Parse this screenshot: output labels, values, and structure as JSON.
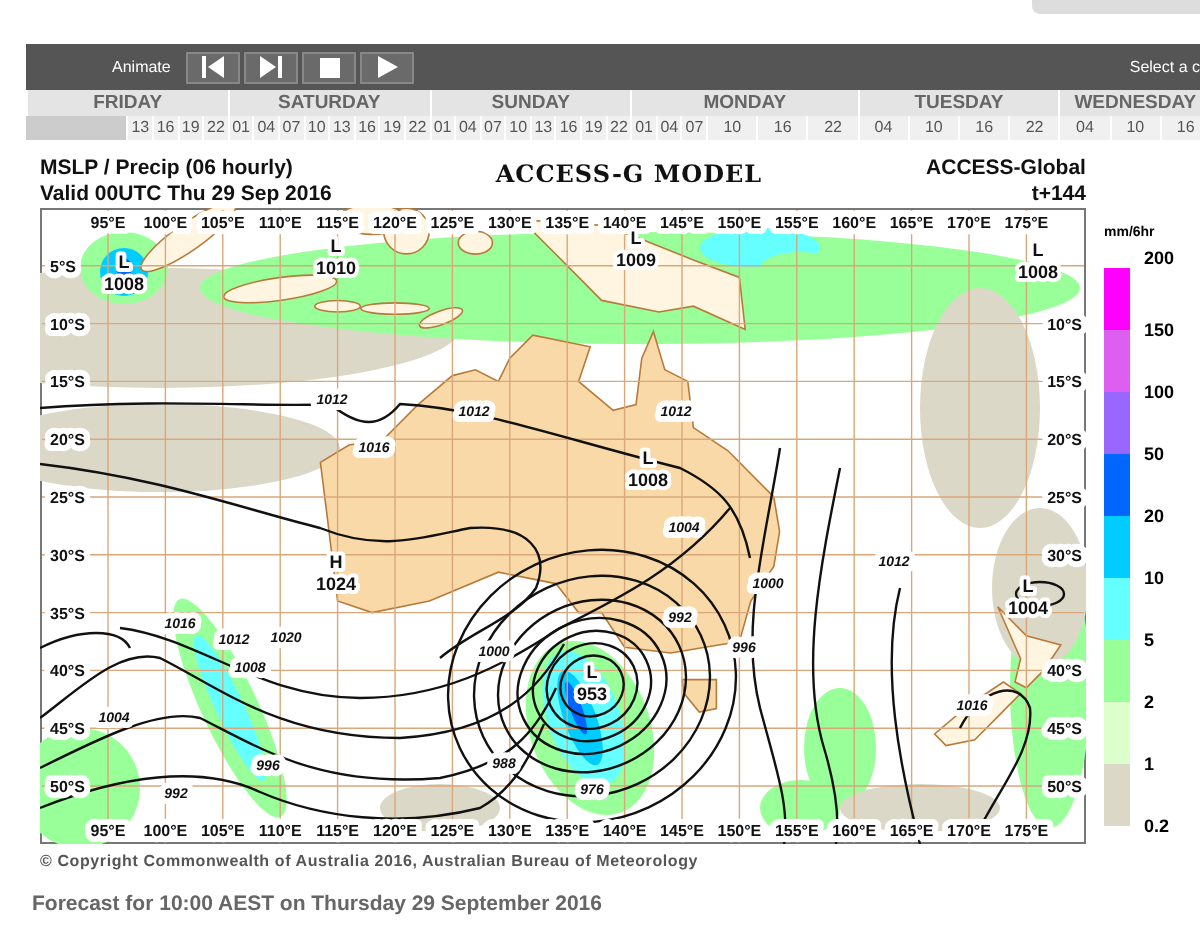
{
  "toolbar": {
    "label": "Animate",
    "buttons": [
      {
        "kind": "first"
      },
      {
        "kind": "next"
      },
      {
        "kind": "stop"
      },
      {
        "kind": "play"
      }
    ],
    "select_label": "Select a c"
  },
  "days": [
    {
      "name": "FRIDAY",
      "hours": [
        "13",
        "16",
        "19",
        "22"
      ]
    },
    {
      "name": "SATURDAY",
      "hours": [
        "01",
        "04",
        "07",
        "10",
        "13",
        "16",
        "19",
        "22"
      ]
    },
    {
      "name": "SUNDAY",
      "hours": [
        "01",
        "04",
        "07",
        "10",
        "13",
        "16",
        "19",
        "22"
      ]
    },
    {
      "name": "MONDAY",
      "hours": [
        "01",
        "04",
        "07",
        "10",
        "16",
        "22"
      ]
    },
    {
      "name": "TUESDAY",
      "hours": [
        "04",
        "10",
        "16",
        "22"
      ]
    },
    {
      "name": "WEDNESDAY",
      "hours": [
        "04",
        "10",
        "16"
      ]
    }
  ],
  "header": {
    "left_lines": [
      "MSLP / Precip  (06 hourly)",
      "Valid 00UTC Thu 29 Sep 2016"
    ],
    "title": "ACCESS-G MODEL",
    "right_lines": [
      "ACCESS-Global",
      "t+144"
    ]
  },
  "map": {
    "top_axis_labels": [
      "95°E",
      "100°E",
      "105°E",
      "110°E",
      "115°E",
      "120°E",
      "125°E",
      "130°E",
      "135°E",
      "140°E",
      "145°E",
      "150°E",
      "155°E",
      "160°E",
      "165°E",
      "170°E",
      "175°E"
    ],
    "bottom_axis_labels": [
      "95°E",
      "100°E",
      "105°E",
      "110°E",
      "115°E",
      "120°E",
      "125°E",
      "130°E",
      "135°E",
      "140°E",
      "145°E",
      "150°E",
      "155°E",
      "160°E",
      "165°E",
      "170°E",
      "175°E"
    ],
    "left_axis_labels": [
      "5°S",
      "10°S",
      "15°S",
      "20°S",
      "25°S",
      "30°S",
      "35°S",
      "40°S",
      "45°S",
      "50°S"
    ],
    "right_axis_labels": [
      "10°S",
      "15°S",
      "20°S",
      "25°S",
      "30°S",
      "40°S",
      "45°S",
      "50°S"
    ],
    "systems": [
      {
        "letter": "L",
        "value": "1008"
      },
      {
        "letter": "L",
        "value": "1010"
      },
      {
        "letter": "L",
        "value": "1009"
      },
      {
        "letter": "L",
        "value": "1008"
      },
      {
        "letter": "H",
        "value": "1024"
      },
      {
        "letter": "L",
        "value": "1008"
      },
      {
        "letter": "L",
        "value": "1004"
      },
      {
        "letter": "L",
        "value": "953"
      }
    ],
    "isobar_labels": [
      "1012",
      "1012",
      "1016",
      "1016",
      "1012",
      "1020",
      "1008",
      "1004",
      "996",
      "992",
      "1000",
      "988",
      "1004",
      "992",
      "976",
      "996",
      "1000",
      "1012",
      "1012",
      "1016"
    ]
  },
  "legend": {
    "unit": "mm/6hr",
    "top_label": "200",
    "bins": [
      {
        "color": "#ff00ff",
        "label": "150"
      },
      {
        "color": "#dd5ef0",
        "label": "100"
      },
      {
        "color": "#9966ff",
        "label": "50"
      },
      {
        "color": "#0066ff",
        "label": "20"
      },
      {
        "color": "#00ccff",
        "label": "10"
      },
      {
        "color": "#66ffff",
        "label": "5"
      },
      {
        "color": "#99ff99",
        "label": "2"
      },
      {
        "color": "#ddffcc",
        "label": "1"
      },
      {
        "color": "#dcd8c8",
        "label": "0.2"
      }
    ]
  },
  "copyright": "© Copyright Commonwealth of Australia 2016, Australian Bureau of Meteorology",
  "forecast": "Forecast for 10:00 AEST on Thursday 29 September 2016"
}
